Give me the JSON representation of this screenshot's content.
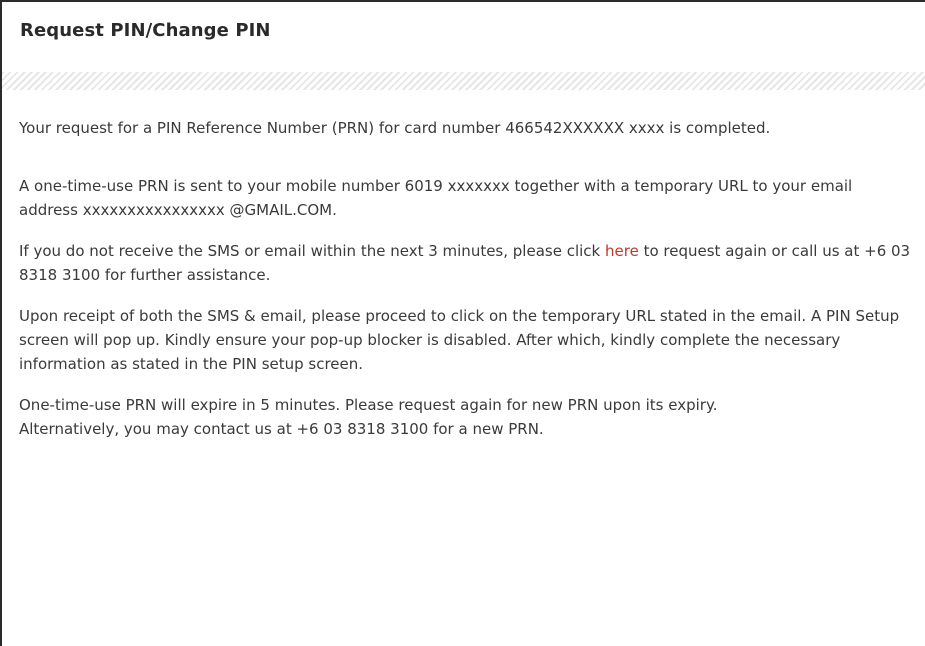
{
  "page": {
    "title": "Request PIN/Change PIN"
  },
  "content": {
    "p1": "Your request for a PIN Reference Number (PRN) for card number 466542XXXXXX xxxx is completed.",
    "p2": "A one-time-use PRN is sent to your mobile number 6019 xxxxxxx  together with a temporary URL to your email address xxxxxxxxxxxxxxxx @GMAIL.COM.",
    "p3_before": "If you do not receive the SMS or email within the next 3 minutes, please click ",
    "p3_link": "here",
    "p3_after": " to request again or call us at +6 03 8318 3100 for further assistance.",
    "p4": "Upon receipt of both the SMS & email, please proceed to click on the temporary URL stated in the email. A PIN Setup screen will pop up. Kindly ensure your pop-up blocker is disabled. After which, kindly complete the necessary information as stated in the PIN setup screen.",
    "p5_line1": "One-time-use PRN will expire in 5 minutes. Please request again for new PRN upon its expiry.",
    "p5_line2": "Alternatively, you may contact us at +6 03 8318 3100 for a new PRN."
  },
  "colors": {
    "link": "#c0392b",
    "text": "#3a3a3a",
    "border": "#2b2b2b"
  }
}
